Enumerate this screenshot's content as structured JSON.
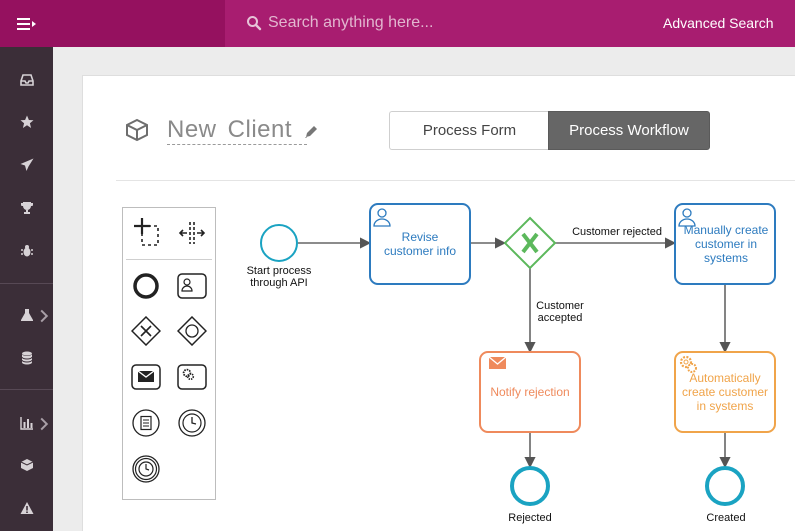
{
  "header": {
    "search_placeholder": "Search anything here...",
    "advanced_search_label": "Advanced Search"
  },
  "sidebar": {
    "items": [
      {
        "icon": "inbox-icon"
      },
      {
        "icon": "star-icon"
      },
      {
        "icon": "paper-plane-icon"
      },
      {
        "icon": "trophy-icon"
      },
      {
        "icon": "bug-icon"
      },
      {
        "icon": "flask-icon"
      },
      {
        "icon": "database-icon"
      },
      {
        "icon": "bar-chart-icon"
      },
      {
        "icon": "cube-icon"
      },
      {
        "icon": "warning-icon"
      }
    ]
  },
  "process": {
    "name": "New  Client",
    "tabs": [
      {
        "label": "Process Form",
        "active": false
      },
      {
        "label": "Process Workflow",
        "active": true
      }
    ]
  },
  "diagram": {
    "start_event": {
      "label_line1": "Start process",
      "label_line2": "through API"
    },
    "task_revise": {
      "line1": "Revise",
      "line2": "customer info"
    },
    "gateway_label_right": "Customer rejected",
    "gateway_label_down_line1": "Customer",
    "gateway_label_down_line2": "accepted",
    "task_manual": {
      "line1": "Manually create",
      "line2": "customer in",
      "line3": "systems"
    },
    "task_notify": {
      "line1": "Notify rejection"
    },
    "task_auto": {
      "line1": "Automatically",
      "line2": "create customer",
      "line3": "in systems"
    },
    "end_rejected": "Rejected",
    "end_created": "Created"
  },
  "colors": {
    "brand": "#95115f",
    "task_blue": "#2d7bbf",
    "gateway_green": "#5cb85c",
    "orange": "#ef8a5c",
    "auto_orange": "#f0a44a",
    "event_teal": "#1aa3c2"
  }
}
